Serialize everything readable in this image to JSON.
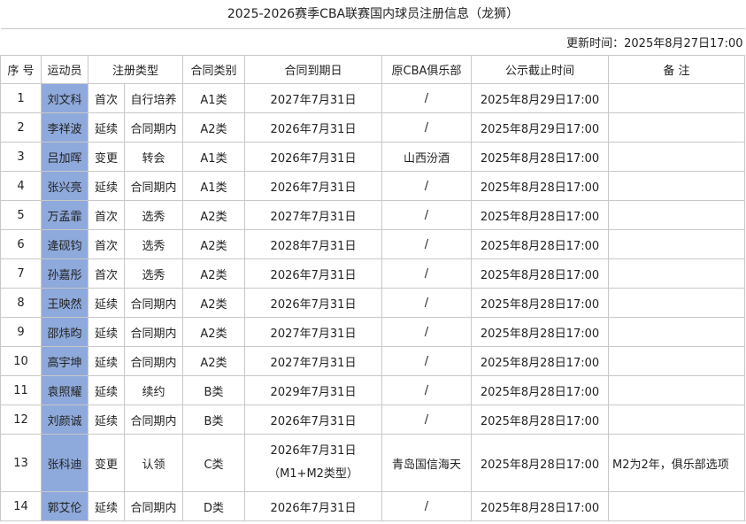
{
  "title": "2025-2026赛季CBA联赛国内球员注册信息（龙狮）",
  "update_time": "更新时间：2025年8月27日17:00",
  "headers": [
    "序 号",
    "运动员",
    "注册类型",
    "合同类别",
    "合同到期日",
    "原CBA俱乐部",
    "公示截止时间",
    "备 注"
  ],
  "rows": [
    {
      "no": "1",
      "name": "刘文科",
      "reg1": "首次",
      "reg2": "自行培养",
      "cat": "A1类",
      "expiry": "2027年7月31日",
      "club": "/",
      "deadline": "2025年8月29日17:00",
      "note": ""
    },
    {
      "no": "2",
      "name": "李祥波",
      "reg1": "延续",
      "reg2": "合同期内",
      "cat": "A2类",
      "expiry": "2026年7月31日",
      "club": "/",
      "deadline": "2025年8月29日17:00",
      "note": ""
    },
    {
      "no": "3",
      "name": "吕加晖",
      "reg1": "变更",
      "reg2": "转会",
      "cat": "A1类",
      "expiry": "2026年7月31日",
      "club": "山西汾酒",
      "deadline": "2025年8月28日17:00",
      "note": ""
    },
    {
      "no": "4",
      "name": "张兴亮",
      "reg1": "延续",
      "reg2": "合同期内",
      "cat": "A1类",
      "expiry": "2026年7月31日",
      "club": "/",
      "deadline": "2025年8月28日17:00",
      "note": ""
    },
    {
      "no": "5",
      "name": "万孟霏",
      "reg1": "首次",
      "reg2": "选秀",
      "cat": "A2类",
      "expiry": "2027年7月31日",
      "club": "/",
      "deadline": "2025年8月28日17:00",
      "note": ""
    },
    {
      "no": "6",
      "name": "逄砚钧",
      "reg1": "首次",
      "reg2": "选秀",
      "cat": "A2类",
      "expiry": "2028年7月31日",
      "club": "/",
      "deadline": "2025年8月28日17:00",
      "note": ""
    },
    {
      "no": "7",
      "name": "孙嘉彤",
      "reg1": "首次",
      "reg2": "选秀",
      "cat": "A2类",
      "expiry": "2026年7月31日",
      "club": "/",
      "deadline": "2025年8月28日17:00",
      "note": ""
    },
    {
      "no": "8",
      "name": "王映然",
      "reg1": "延续",
      "reg2": "合同期内",
      "cat": "A2类",
      "expiry": "2026年7月31日",
      "club": "/",
      "deadline": "2025年8月28日17:00",
      "note": ""
    },
    {
      "no": "9",
      "name": "邵炜昀",
      "reg1": "延续",
      "reg2": "合同期内",
      "cat": "A2类",
      "expiry": "2027年7月31日",
      "club": "/",
      "deadline": "2025年8月28日17:00",
      "note": ""
    },
    {
      "no": "10",
      "name": "高宇坤",
      "reg1": "延续",
      "reg2": "合同期内",
      "cat": "A2类",
      "expiry": "2027年7月31日",
      "club": "/",
      "deadline": "2025年8月28日17:00",
      "note": ""
    },
    {
      "no": "11",
      "name": "袁照耀",
      "reg1": "延续",
      "reg2": "续约",
      "cat": "B类",
      "expiry": "2029年7月31日",
      "club": "/",
      "deadline": "2025年8月28日17:00",
      "note": ""
    },
    {
      "no": "12",
      "name": "刘颜诚",
      "reg1": "延续",
      "reg2": "合同期内",
      "cat": "B类",
      "expiry": "2026年7月31日",
      "club": "/",
      "deadline": "2025年8月28日17:00",
      "note": ""
    },
    {
      "no": "13",
      "name": "张科迪",
      "reg1": "变更",
      "reg2": "认领",
      "cat": "C类",
      "expiry": "2026年7月31日",
      "expiry2": "（M1+M2类型）",
      "club": "青岛国信海天",
      "deadline": "2025年8月28日17:00",
      "note": "M2为2年，俱乐部选项"
    },
    {
      "no": "14",
      "name": "郭艾伦",
      "reg1": "延续",
      "reg2": "合同期内",
      "cat": "D类",
      "expiry": "2026年7月31日",
      "club": "/",
      "deadline": "2025年8月28日17:00",
      "note": ""
    }
  ]
}
